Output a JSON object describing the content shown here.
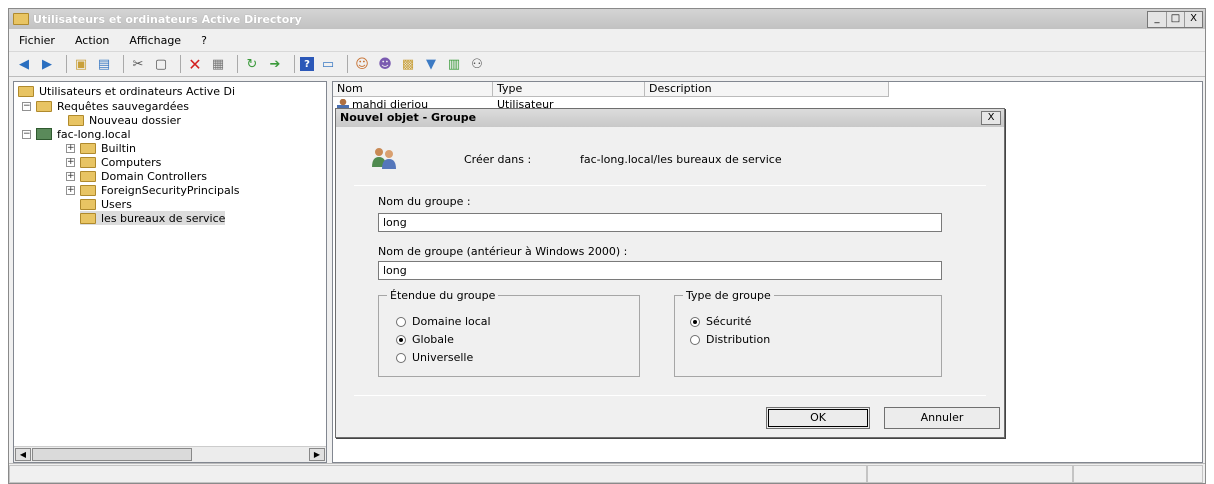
{
  "window": {
    "title": "Utilisateurs et ordinateurs Active Directory",
    "controls": [
      "_",
      "□",
      "X"
    ]
  },
  "menu": [
    "Fichier",
    "Action",
    "Affichage",
    "?"
  ],
  "toolbar_icons": [
    "back-icon",
    "forward-icon",
    "up-folder-icon",
    "show-tree-icon",
    "cut-icon",
    "copy-icon",
    "delete-icon",
    "properties-icon",
    "refresh-icon",
    "export-icon",
    "help-icon",
    "console-icon",
    "new-user-icon",
    "new-group-icon",
    "new-ou-icon",
    "filter-icon",
    "find-icon",
    "add-to-group-icon"
  ],
  "tree": {
    "root": "Utilisateurs et ordinateurs Active Di",
    "items": [
      {
        "label": "Requêtes sauvegardées",
        "expander": "−"
      },
      {
        "label": "Nouveau dossier",
        "expander": ""
      },
      {
        "label": "fac-long.local",
        "expander": "−"
      },
      {
        "label": "Builtin",
        "expander": "+"
      },
      {
        "label": "Computers",
        "expander": "+"
      },
      {
        "label": "Domain Controllers",
        "expander": "+"
      },
      {
        "label": "ForeignSecurityPrincipals",
        "expander": "+"
      },
      {
        "label": "Users",
        "expander": ""
      },
      {
        "label": "les bureaux de service",
        "expander": ""
      }
    ]
  },
  "list": {
    "columns": [
      "Nom",
      "Type",
      "Description"
    ],
    "rows": [
      {
        "name": "mahdi djeriou",
        "type": "Utilisateur",
        "description": ""
      }
    ]
  },
  "dialog": {
    "title": "Nouvel objet - Groupe",
    "close": "X",
    "create_in_label": "Créer dans :",
    "create_in_value": "fac-long.local/les bureaux de service",
    "group_name_label": "Nom du groupe :",
    "group_name_value": "long",
    "pre2000_label": "Nom de groupe (antérieur à Windows 2000) :",
    "pre2000_value": "long",
    "scope": {
      "legend": "Étendue du groupe",
      "options": [
        "Domaine local",
        "Globale",
        "Universelle"
      ],
      "selected": "Globale"
    },
    "type": {
      "legend": "Type de groupe",
      "options": [
        "Sécurité",
        "Distribution"
      ],
      "selected": "Sécurité"
    },
    "ok": "OK",
    "cancel": "Annuler"
  }
}
